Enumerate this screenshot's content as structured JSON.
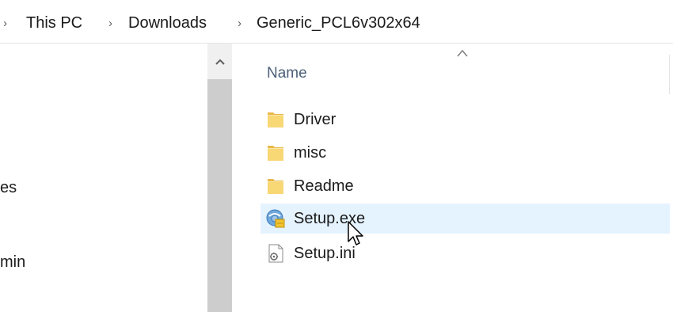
{
  "address_bar": {
    "crumbs": [
      "This PC",
      "Downloads",
      "Generic_PCL6v302x64"
    ]
  },
  "nav_pane": {
    "items": [
      {
        "label": "es"
      },
      {
        "label": "min"
      }
    ]
  },
  "file_list": {
    "column_name": "Name",
    "files": [
      {
        "name": "Driver",
        "icon": "folder-icon"
      },
      {
        "name": "misc",
        "icon": "folder-icon"
      },
      {
        "name": "Readme",
        "icon": "folder-icon"
      },
      {
        "name": "Setup.exe",
        "icon": "setup-exe-icon",
        "hovered": true
      },
      {
        "name": "Setup.ini",
        "icon": "config-file-icon"
      }
    ]
  },
  "colors": {
    "hover_bg": "#e5f3ff",
    "folder_yellow": "#f8d775",
    "header_text": "#4c607a",
    "scrollbar_track": "#f0f0f0",
    "scrollbar_thumb": "#cdcdcd"
  }
}
